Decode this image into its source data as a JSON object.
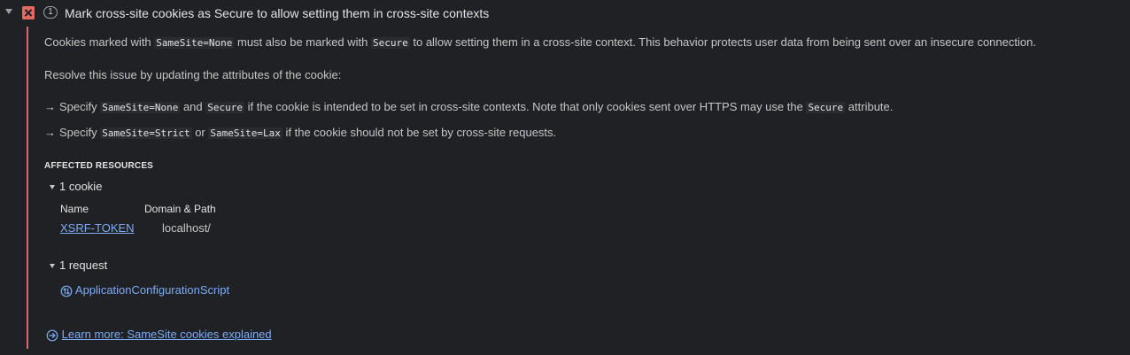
{
  "issue": {
    "count": "1",
    "title": "Mark cross-site cookies as Secure to allow setting them in cross-site contexts",
    "icon": "error-icon",
    "accent_color": "#e46962"
  },
  "body": {
    "p1": {
      "t1": "Cookies marked with ",
      "c1": "SameSite=None",
      "t2": " must also be marked with ",
      "c2": "Secure",
      "t3": " to allow setting them in a cross-site context. This behavior protects user data from being sent over an insecure connection."
    },
    "p2": "Resolve this issue by updating the attributes of the cookie:",
    "arrow": "→",
    "b1": {
      "t1": "Specify ",
      "c1": "SameSite=None",
      "t2": " and ",
      "c2": "Secure",
      "t3": " if the cookie is intended to be set in cross-site contexts. Note that only cookies sent over HTTPS may use the ",
      "c3": "Secure",
      "t4": " attribute."
    },
    "b2": {
      "t1": "Specify ",
      "c1": "SameSite=Strict",
      "t2": " or ",
      "c2": "SameSite=Lax",
      "t3": " if the cookie should not be set by cross-site requests."
    }
  },
  "affected": {
    "title": "AFFECTED RESOURCES",
    "cookies": {
      "label": "1 cookie",
      "col_name": "Name",
      "col_domain": "Domain & Path",
      "rows": [
        {
          "name": "XSRF-TOKEN",
          "domain": "localhost/"
        }
      ]
    },
    "requests": {
      "label": "1 request",
      "items": [
        "ApplicationConfigurationScript"
      ]
    }
  },
  "learn_more": "Learn more: SameSite cookies explained",
  "link_color": "#7cacf8"
}
